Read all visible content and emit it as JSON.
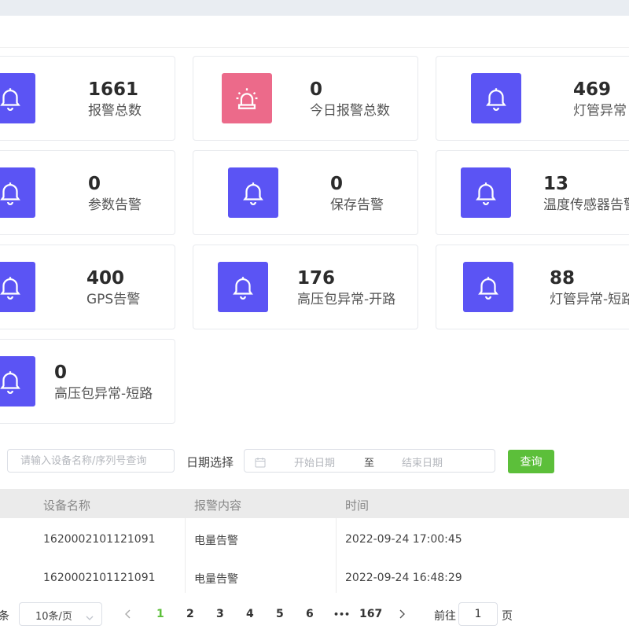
{
  "colors": {
    "accent": "#5b54f4",
    "alert": "#ec6a8a",
    "success": "#5cbf3a"
  },
  "stats": [
    {
      "value": "1661",
      "label": "报警总数",
      "icon": "bell-icon"
    },
    {
      "value": "0",
      "label": "今日报警总数",
      "icon": "siren-icon"
    },
    {
      "value": "469",
      "label": "灯管异常",
      "icon": "bell-icon"
    },
    {
      "value": "0",
      "label": "参数告警",
      "icon": "bell-icon"
    },
    {
      "value": "0",
      "label": "保存告警",
      "icon": "bell-icon"
    },
    {
      "value": "13",
      "label": "温度传感器告警",
      "icon": "bell-icon"
    },
    {
      "value": "400",
      "label": "GPS告警",
      "icon": "bell-icon"
    },
    {
      "value": "176",
      "label": "高压包异常-开路",
      "icon": "bell-icon"
    },
    {
      "value": "88",
      "label": "灯管异常-短路",
      "icon": "bell-icon"
    },
    {
      "value": "0",
      "label": "高压包异常-短路",
      "icon": "bell-icon"
    }
  ],
  "filters": {
    "search_placeholder": "请输入设备名称/序列号查询",
    "date_label": "日期选择",
    "start_placeholder": "开始日期",
    "separator": "至",
    "end_placeholder": "结束日期",
    "query_button": "查询"
  },
  "table": {
    "columns": [
      "设备名称",
      "报警内容",
      "时间"
    ],
    "rows": [
      [
        "1620002101121091",
        "电量告警",
        "2022-09-24 17:00:45"
      ],
      [
        "1620002101121091",
        "电量告警",
        "2022-09-24 16:48:29"
      ]
    ]
  },
  "pagination": {
    "total_suffix": "条",
    "page_size": "10条/页",
    "pages": [
      "1",
      "2",
      "3",
      "4",
      "5",
      "6"
    ],
    "ellipsis": "•••",
    "last_page": "167",
    "current_page": "1",
    "goto_label": "前往",
    "goto_value": "1",
    "page_suffix": "页"
  }
}
